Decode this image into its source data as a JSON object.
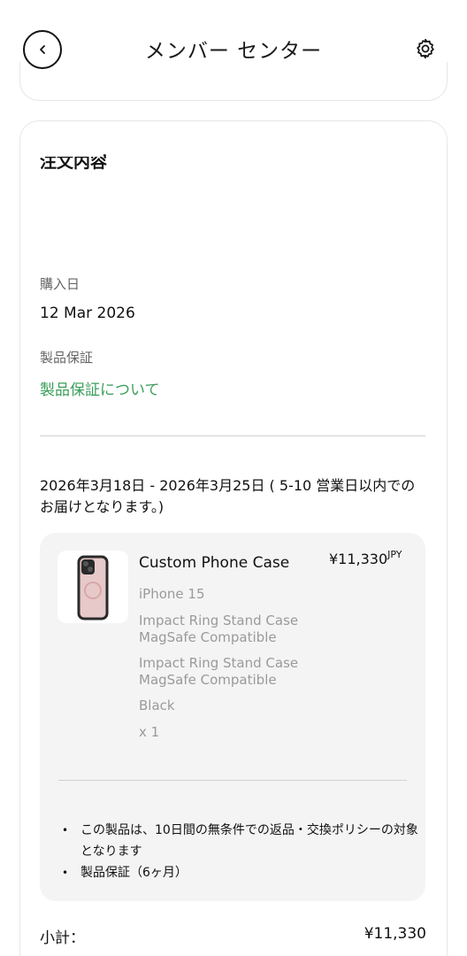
{
  "header": {
    "title": "メンバー センター",
    "back_icon": "chevron-left-icon",
    "settings_icon": "gear-icon"
  },
  "order": {
    "section_title": "注文内容",
    "purchase_date_label": "購入日",
    "purchase_date": "12 Mar 2026",
    "warranty_label": "製品保証",
    "warranty_link": "製品保証について",
    "delivery_text": "2026年3月18日 - 2026年3月25日 ( 5-10 営業日以内でのお届けとなります。)"
  },
  "product": {
    "name": "Custom Phone Case",
    "price": "¥11,330",
    "currency": "JPY",
    "model": "iPhone 15",
    "case_type": "Impact Ring Stand Case MagSafe Compatible",
    "case_type_2": "Impact Ring Stand Case MagSafe Compatible",
    "color": "Black",
    "quantity": "x 1"
  },
  "policies": [
    "この製品は、10日間の無条件での返品・交換ポリシーの対象となります",
    "製品保証（6ヶ月）"
  ],
  "summary": {
    "subtotal_label": "小計：",
    "subtotal_value": "¥11,330"
  },
  "colors": {
    "link_green": "#3a9e5a",
    "panel_bg": "#f4f4f4"
  }
}
